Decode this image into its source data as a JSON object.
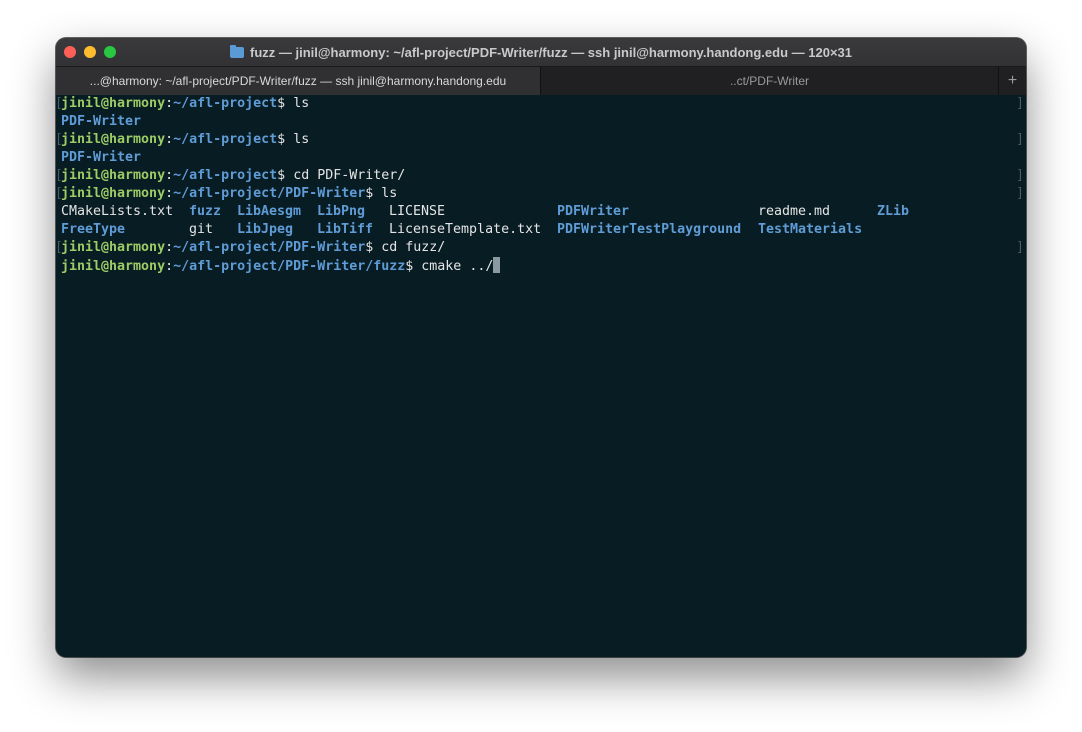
{
  "window": {
    "title": "fuzz — jinil@harmony: ~/afl-project/PDF-Writer/fuzz — ssh jinil@harmony.handong.edu — 120×31"
  },
  "tabs": [
    {
      "label": "...@harmony: ~/afl-project/PDF-Writer/fuzz — ssh jinil@harmony.handong.edu"
    },
    {
      "label": "..ct/PDF-Writer"
    }
  ],
  "new_tab_label": "+",
  "terminal": {
    "user": "jinil@harmony",
    "lines": [
      {
        "path": "~/afl-project",
        "cmd": " ls"
      },
      {
        "output": "PDF-Writer"
      },
      {
        "path": "~/afl-project",
        "cmd": " ls"
      },
      {
        "output": "PDF-Writer"
      },
      {
        "path": "~/afl-project",
        "cmd": " cd PDF-Writer/"
      },
      {
        "path": "~/afl-project/PDF-Writer",
        "cmd": " ls"
      },
      {
        "path": "~/afl-project/PDF-Writer",
        "cmd": " cd fuzz/"
      },
      {
        "path": "~/afl-project/PDF-Writer/fuzz",
        "cmd": " cmake ../"
      }
    ],
    "listing": {
      "row1": [
        "CMakeLists.txt",
        "fuzz",
        "LibAesgm",
        "LibPng",
        "LICENSE",
        "PDFWriter",
        "readme.md",
        "ZLib"
      ],
      "row2": [
        "FreeType",
        "git",
        "LibJpeg",
        "LibTiff",
        "LicenseTemplate.txt",
        "PDFWriterTestPlayground",
        "TestMaterials"
      ]
    }
  },
  "colors": {
    "background": "#081c24",
    "user": "#9ccc65",
    "directory": "#5f9cd6",
    "text": "#e4e4e4"
  }
}
